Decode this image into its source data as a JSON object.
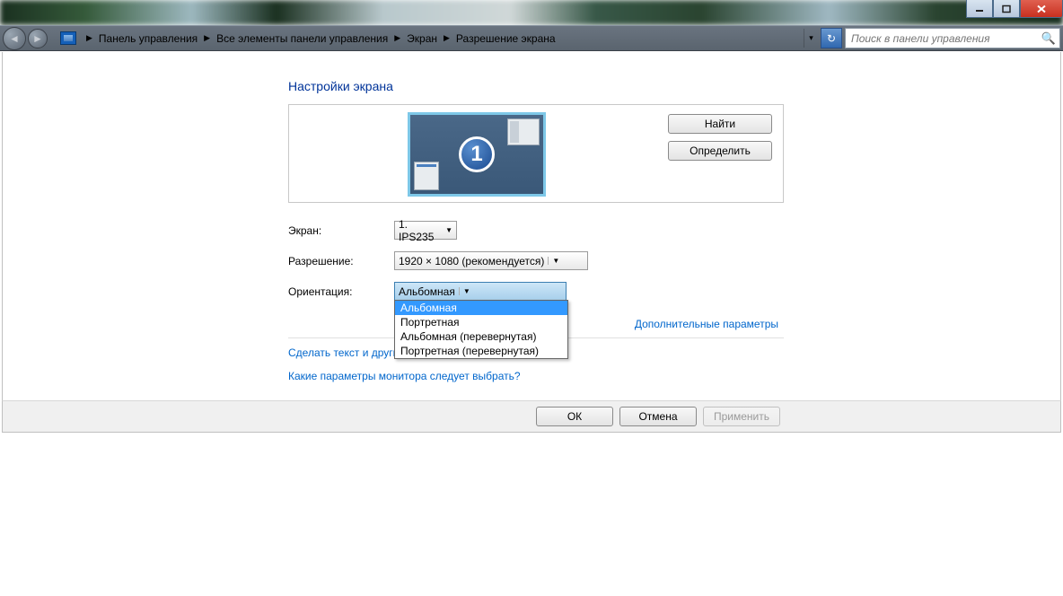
{
  "window_controls": {
    "minimize": "_",
    "maximize": "□",
    "close": "✕"
  },
  "breadcrumb": {
    "items": [
      "Панель управления",
      "Все элементы панели управления",
      "Экран",
      "Разрешение экрана"
    ]
  },
  "search": {
    "placeholder": "Поиск в панели управления"
  },
  "page": {
    "title": "Настройки экрана"
  },
  "preview": {
    "monitor_number": "1",
    "find_btn": "Найти",
    "detect_btn": "Определить"
  },
  "form": {
    "screen_label": "Экран:",
    "screen_value": "1. IPS235",
    "resolution_label": "Разрешение:",
    "resolution_value": "1920 × 1080 (рекомендуется)",
    "orientation_label": "Ориентация:",
    "orientation_value": "Альбомная",
    "orientation_options": [
      "Альбомная",
      "Портретная",
      "Альбомная (перевернутая)",
      "Портретная (перевернутая)"
    ]
  },
  "links": {
    "advanced": "Дополнительные параметры",
    "text_size": "Сделать текст и другие",
    "which_params": "Какие параметры монитора следует выбрать?"
  },
  "buttons": {
    "ok": "ОК",
    "cancel": "Отмена",
    "apply": "Применить"
  }
}
